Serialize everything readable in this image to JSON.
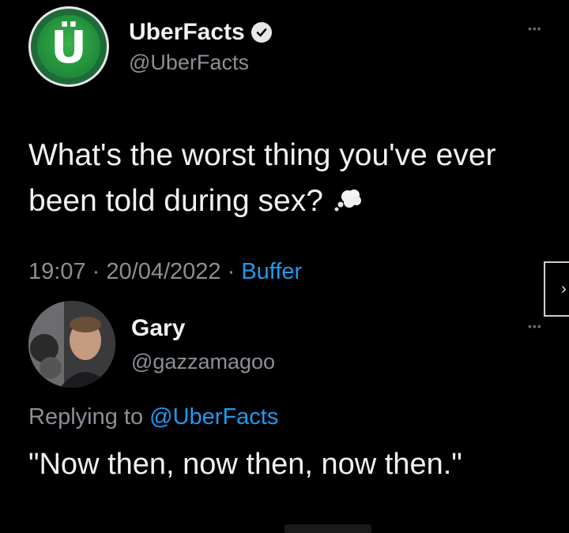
{
  "tweet": {
    "author": {
      "name": "UberFacts",
      "handle": "@UberFacts",
      "verified": true,
      "avatar_icon": "uberfacts-logo-icon",
      "avatar_color": "#1f8a3a"
    },
    "text": "What's the worst thing you've ever been told during sex?",
    "emoji": "cloud-icon",
    "time": "19:07",
    "separator": "·",
    "date": "20/04/2022",
    "source": "Buffer",
    "more_icon": "more-dots-icon"
  },
  "reply": {
    "author": {
      "name": "Gary",
      "handle": "@gazzamagoo",
      "avatar_icon": "profile-photo-avatar"
    },
    "replying_prefix": "Replying to",
    "replying_to": "@UberFacts",
    "text": "\"Now then, now then, now then.\"",
    "more_icon": "more-dots-icon"
  },
  "colors": {
    "background": "#000000",
    "text": "#e7e9ea",
    "secondary": "#8b9098",
    "link": "#1d9bf0"
  }
}
